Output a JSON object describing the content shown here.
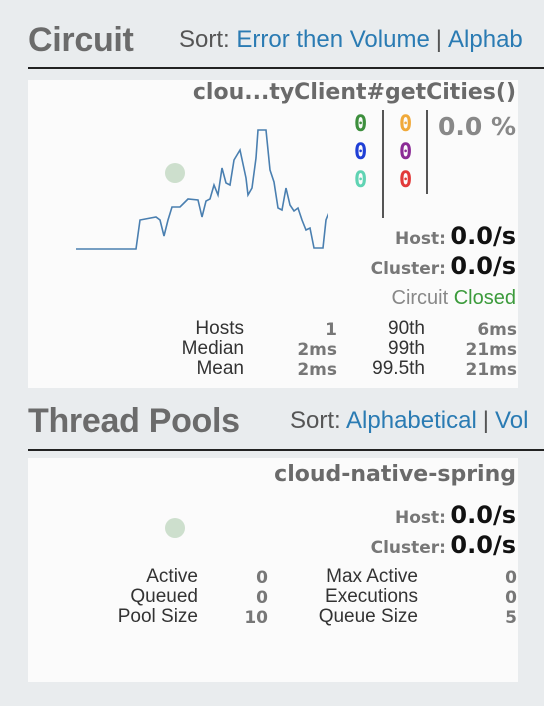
{
  "circuit_section": {
    "title": "Circuit",
    "sort_label": "Sort:",
    "sort_options": [
      "Error then Volume",
      "Alphab"
    ]
  },
  "circuit_panel": {
    "name": "clou...tyClient#getCities()",
    "counts": {
      "success": "0",
      "short_circuited": "0",
      "bad_request": "0",
      "timeout": "0",
      "rejected": "0",
      "failure": "0"
    },
    "error_percentage": "0.0 %",
    "host_label": "Host:",
    "host_rate": "0.0/s",
    "cluster_label": "Cluster:",
    "cluster_rate": "0.0/s",
    "circuit_label": "Circuit",
    "circuit_status": "Closed",
    "stats": {
      "hosts_label": "Hosts",
      "hosts": "1",
      "median_label": "Median",
      "median": "2ms",
      "mean_label": "Mean",
      "mean": "2ms",
      "p90_label": "90th",
      "p90": "6ms",
      "p99_label": "99th",
      "p99": "21ms",
      "p995_label": "99.5th",
      "p995": "21ms"
    },
    "colors": {
      "success": "#3d8f3d",
      "short_circuited": "#1f3fd6",
      "bad_request": "#5fd3b3",
      "timeout": "#f0a93a",
      "rejected": "#8b2b96",
      "failure": "#e23a3a",
      "sparkline": "#4a7fb0",
      "health_dot": "#cddfcd"
    }
  },
  "thread_pools_section": {
    "title": "Thread Pools",
    "sort_label": "Sort:",
    "sort_options": [
      "Alphabetical",
      "Vol"
    ]
  },
  "thread_pool_panel": {
    "name": "cloud-native-spring",
    "host_label": "Host:",
    "host_rate": "0.0/s",
    "cluster_label": "Cluster:",
    "cluster_rate": "0.0/s",
    "stats": {
      "active_label": "Active",
      "active": "0",
      "queued_label": "Queued",
      "queued": "0",
      "pool_size_label": "Pool Size",
      "pool_size": "10",
      "max_active_label": "Max Active",
      "max_active": "0",
      "executions_label": "Executions",
      "executions": "0",
      "queue_size_label": "Queue Size",
      "queue_size": "5"
    }
  }
}
